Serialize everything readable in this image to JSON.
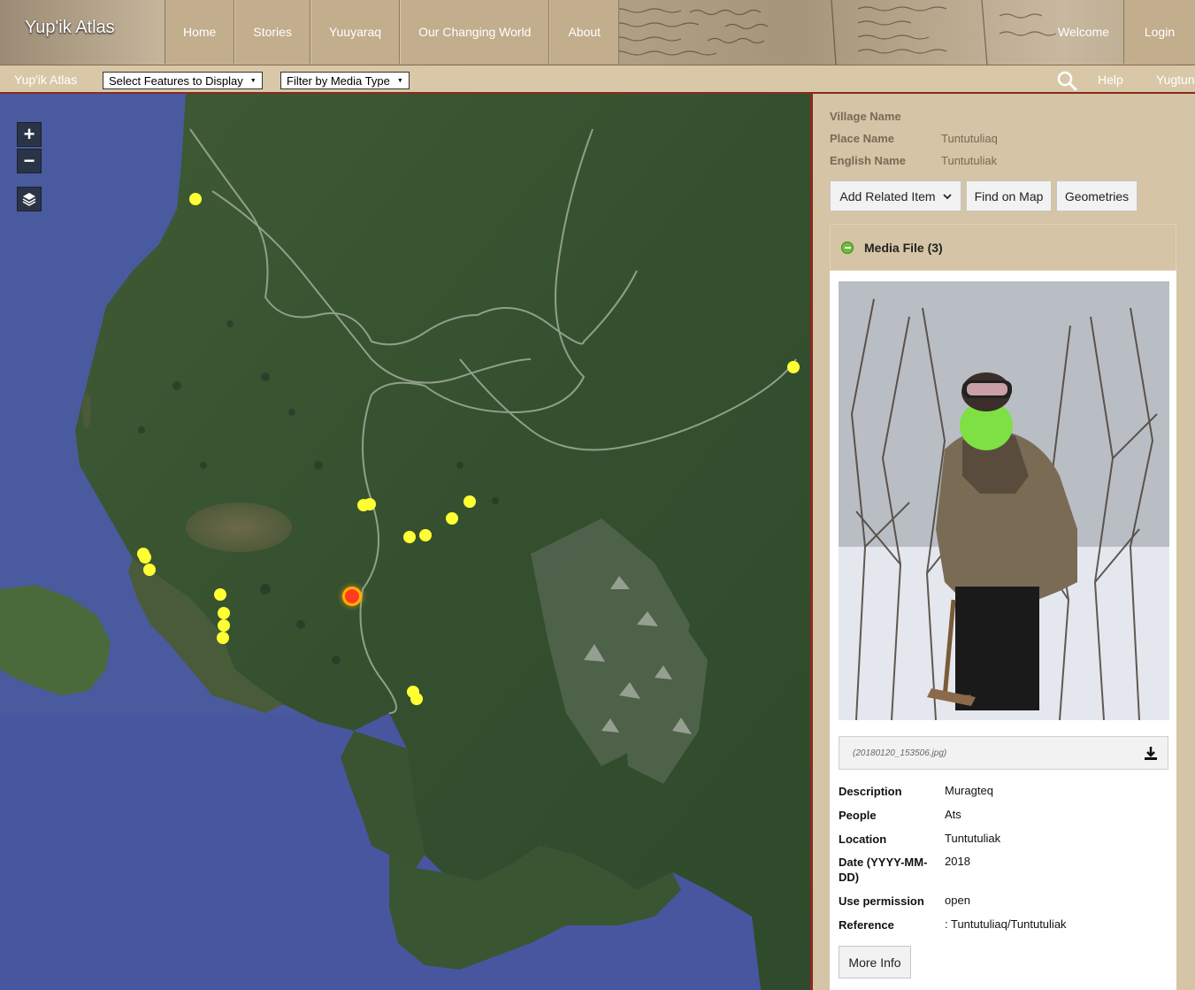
{
  "header": {
    "brand": "Yup'ik Atlas",
    "nav": [
      "Home",
      "Stories",
      "Yuuyaraq",
      "Our Changing World",
      "About"
    ],
    "welcome": "Welcome",
    "login": "Login"
  },
  "toolbar": {
    "brand": "Yup'ik Atlas",
    "features_select": "Select Features to Display",
    "media_select": "Filter by Media Type",
    "help": "Help",
    "language": "Yugtun"
  },
  "map": {
    "zoom_in": "+",
    "zoom_out": "−",
    "marker_color": "#ffff33",
    "active_marker_color": "#ff3b1f"
  },
  "panel": {
    "village_name_label": "Village Name",
    "village_name_value": "",
    "place_name_label": "Place Name",
    "place_name_value": "Tuntutuliaq",
    "english_name_label": "English Name",
    "english_name_value": "Tuntutuliak",
    "add_related": "Add Related Item",
    "find_on_map": "Find on Map",
    "geometries": "Geometries",
    "media_title": "Media File (3)",
    "file_name": "(20180120_153506.jpg)",
    "details": [
      {
        "key": "Description",
        "value": "Muragteq"
      },
      {
        "key": "People",
        "value": "Ats"
      },
      {
        "key": "Location",
        "value": "Tuntutuliak"
      },
      {
        "key": "Date (YYYY-MM-DD)",
        "value": "2018"
      },
      {
        "key": "Use permission",
        "value": "open"
      },
      {
        "key": "Reference",
        "value": ": Tuntutuliaq/Tuntutuliak"
      }
    ],
    "more_info": "More Info"
  }
}
